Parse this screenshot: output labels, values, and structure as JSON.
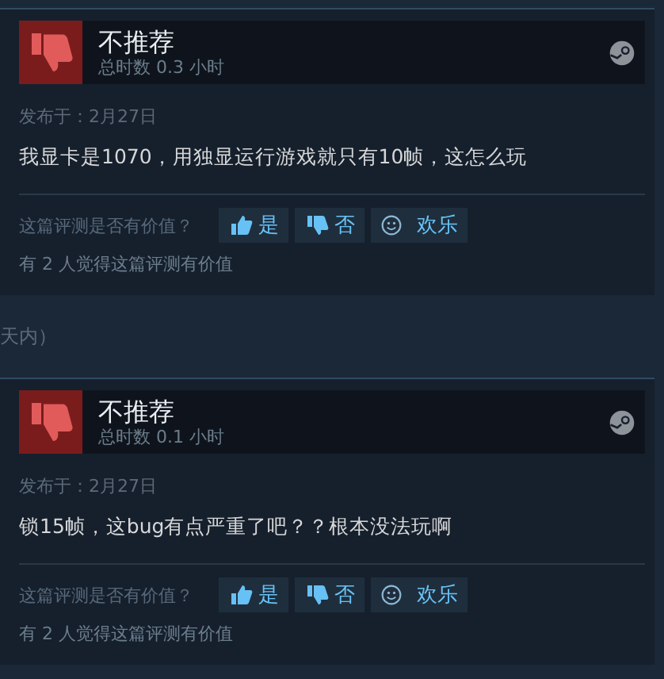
{
  "reviews": [
    {
      "recommended": false,
      "verdict": "不推荐",
      "hours": "总时数 0.3 小时",
      "posted": "发布于：2月27日",
      "text": "我显卡是1070，用独显运行游戏就只有10帧，这怎么玩",
      "helpful_prompt": "这篇评测是否有价值？",
      "buttons": [
        {
          "kind": "yes",
          "label": "是"
        },
        {
          "kind": "no",
          "label": "否"
        },
        {
          "kind": "funny",
          "label": "欢乐"
        }
      ],
      "helpful_count": "有 2 人觉得这篇评测有价值"
    },
    {
      "recommended": false,
      "verdict": "不推荐",
      "hours": "总时数 0.1 小时",
      "posted": "发布于：2月27日",
      "text": "锁15帧，这bug有点严重了吧？？根本没法玩啊",
      "helpful_prompt": "这篇评测是否有价值？",
      "buttons": [
        {
          "kind": "yes",
          "label": "是"
        },
        {
          "kind": "no",
          "label": "否"
        },
        {
          "kind": "funny",
          "label": "欢乐"
        }
      ],
      "helpful_count": "有 2 人觉得这篇评测有价值"
    }
  ],
  "separator_text": "天内）"
}
